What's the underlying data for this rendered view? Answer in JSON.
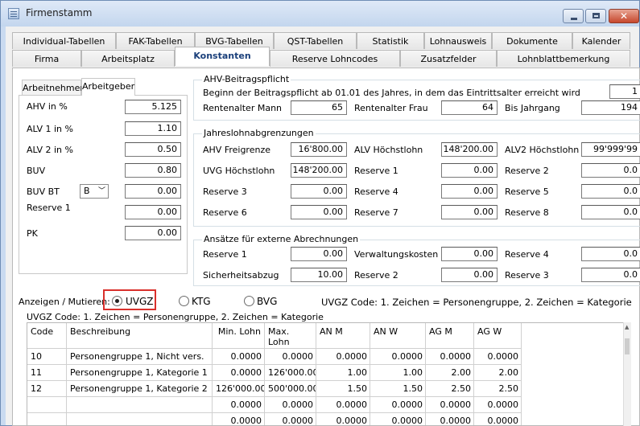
{
  "window": {
    "title": "Firmenstamm"
  },
  "tabs_row1": [
    "Individual-Tabellen",
    "FAK-Tabellen",
    "BVG-Tabellen",
    "QST-Tabellen",
    "Statistik",
    "Lohnausweis",
    "Dokumente",
    "Kalender"
  ],
  "tabs_row2": [
    "Firma",
    "Arbeitsplatz",
    "Konstanten",
    "Reserve Lohncodes",
    "Zusatzfelder",
    "Lohnblattbemerkung"
  ],
  "subtabs": [
    "Arbeitnehmer",
    "Arbeitgeber"
  ],
  "left_panel": {
    "rows": [
      {
        "label": "AHV in %",
        "value": "5.125"
      },
      {
        "label": "ALV 1 in %",
        "value": "1.10"
      },
      {
        "label": "ALV 2 in %",
        "value": "0.50"
      },
      {
        "label": "BUV",
        "value": "0.80"
      },
      {
        "label": "BUV BT",
        "select": "B",
        "value": "0.00"
      },
      {
        "label": "Reserve 1",
        "value": "0.00"
      },
      {
        "label": "PK",
        "value": "0.00"
      }
    ]
  },
  "ahv_group": {
    "title": "AHV-Beitragspflicht",
    "text": "Beginn der Beitragspflicht ab 01.01 des Jahres, in dem das Eintrittsalter erreicht wird",
    "value_start": "1",
    "rentenalter_mann_label": "Rentenalter Mann",
    "rentenalter_mann": "65",
    "rentenalter_frau_label": "Rentenalter Frau",
    "rentenalter_frau": "64",
    "bis_jahrgang_label": "Bis Jahrgang",
    "bis_jahrgang": "194"
  },
  "jahres_group": {
    "title": "Jahreslohnabgrenzungen",
    "rows": [
      [
        {
          "label": "AHV Freigrenze",
          "value": "16'800.00"
        },
        {
          "label": "ALV Höchstlohn",
          "value": "148'200.00"
        },
        {
          "label": "ALV2 Höchstlohn",
          "value": "99'999'99"
        }
      ],
      [
        {
          "label": "UVG Höchstlohn",
          "value": "148'200.00"
        },
        {
          "label": "Reserve 1",
          "value": "0.00"
        },
        {
          "label": "Reserve 2",
          "value": "0.0"
        }
      ],
      [
        {
          "label": "Reserve 3",
          "value": "0.00"
        },
        {
          "label": "Reserve 4",
          "value": "0.00"
        },
        {
          "label": "Reserve 5",
          "value": "0.0"
        }
      ],
      [
        {
          "label": "Reserve 6",
          "value": "0.00"
        },
        {
          "label": "Reserve 7",
          "value": "0.00"
        },
        {
          "label": "Reserve 8",
          "value": "0.0"
        }
      ]
    ]
  },
  "ansaetze_group": {
    "title": "Ansätze für externe Abrechnungen",
    "rows": [
      [
        {
          "label": "Reserve 1",
          "value": "0.00"
        },
        {
          "label": "Verwaltungskosten",
          "value": "0.00"
        },
        {
          "label": "Reserve 4",
          "value": "0.0"
        }
      ],
      [
        {
          "label": "Sicherheitsabzug",
          "value": "10.00"
        },
        {
          "label": "Reserve 2",
          "value": "0.00"
        },
        {
          "label": "Reserve 3",
          "value": "0.0"
        }
      ]
    ]
  },
  "mutieren": {
    "label": "Anzeigen / Mutieren:",
    "options": [
      "UVGZ",
      "KTG",
      "BVG"
    ],
    "selected": "UVGZ",
    "hint": "UVGZ Code: 1. Zeichen = Personengruppe, 2. Zeichen = Kategorie"
  },
  "grid": {
    "caption": "UVGZ Code: 1. Zeichen = Personengruppe, 2. Zeichen = Kategorie",
    "columns": [
      "Code",
      "Beschreibung",
      "Min. Lohn",
      "Max. Lohn",
      "AN M",
      "AN W",
      "AG M",
      "AG W"
    ],
    "rows": [
      [
        "10",
        "Personengruppe 1, Nicht vers.",
        "0.0000",
        "0.0000",
        "0.0000",
        "0.0000",
        "0.0000",
        "0.0000"
      ],
      [
        "11",
        "Personengruppe 1, Kategorie 1",
        "0.0000",
        "126'000.00",
        "1.00",
        "1.00",
        "2.00",
        "2.00"
      ],
      [
        "12",
        "Personengruppe 1, Kategorie 2",
        "126'000.00",
        "500'000.00",
        "1.50",
        "1.50",
        "2.50",
        "2.50"
      ],
      [
        "",
        "",
        "0.0000",
        "0.0000",
        "0.0000",
        "0.0000",
        "0.0000",
        "0.0000"
      ],
      [
        "",
        "",
        "0.0000",
        "0.0000",
        "0.0000",
        "0.0000",
        "0.0000",
        "0.0000"
      ]
    ]
  },
  "colors": {
    "titlebar": "#c3d6ee",
    "active_tab_text": "#1a3f7a",
    "highlight_box": "#d9302c"
  }
}
